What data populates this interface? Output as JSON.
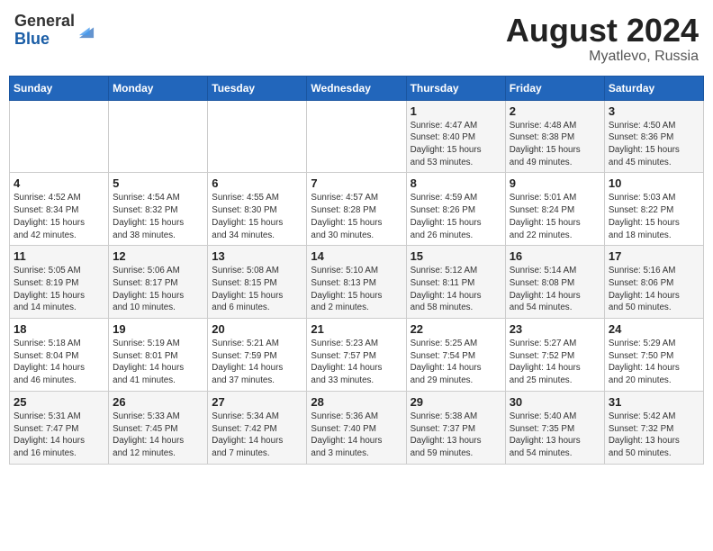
{
  "header": {
    "logo_line1": "General",
    "logo_line2": "Blue",
    "title": "August 2024",
    "location": "Myatlevo, Russia"
  },
  "days_of_week": [
    "Sunday",
    "Monday",
    "Tuesday",
    "Wednesday",
    "Thursday",
    "Friday",
    "Saturday"
  ],
  "weeks": [
    [
      {
        "num": "",
        "info": ""
      },
      {
        "num": "",
        "info": ""
      },
      {
        "num": "",
        "info": ""
      },
      {
        "num": "",
        "info": ""
      },
      {
        "num": "1",
        "info": "Sunrise: 4:47 AM\nSunset: 8:40 PM\nDaylight: 15 hours\nand 53 minutes."
      },
      {
        "num": "2",
        "info": "Sunrise: 4:48 AM\nSunset: 8:38 PM\nDaylight: 15 hours\nand 49 minutes."
      },
      {
        "num": "3",
        "info": "Sunrise: 4:50 AM\nSunset: 8:36 PM\nDaylight: 15 hours\nand 45 minutes."
      }
    ],
    [
      {
        "num": "4",
        "info": "Sunrise: 4:52 AM\nSunset: 8:34 PM\nDaylight: 15 hours\nand 42 minutes."
      },
      {
        "num": "5",
        "info": "Sunrise: 4:54 AM\nSunset: 8:32 PM\nDaylight: 15 hours\nand 38 minutes."
      },
      {
        "num": "6",
        "info": "Sunrise: 4:55 AM\nSunset: 8:30 PM\nDaylight: 15 hours\nand 34 minutes."
      },
      {
        "num": "7",
        "info": "Sunrise: 4:57 AM\nSunset: 8:28 PM\nDaylight: 15 hours\nand 30 minutes."
      },
      {
        "num": "8",
        "info": "Sunrise: 4:59 AM\nSunset: 8:26 PM\nDaylight: 15 hours\nand 26 minutes."
      },
      {
        "num": "9",
        "info": "Sunrise: 5:01 AM\nSunset: 8:24 PM\nDaylight: 15 hours\nand 22 minutes."
      },
      {
        "num": "10",
        "info": "Sunrise: 5:03 AM\nSunset: 8:22 PM\nDaylight: 15 hours\nand 18 minutes."
      }
    ],
    [
      {
        "num": "11",
        "info": "Sunrise: 5:05 AM\nSunset: 8:19 PM\nDaylight: 15 hours\nand 14 minutes."
      },
      {
        "num": "12",
        "info": "Sunrise: 5:06 AM\nSunset: 8:17 PM\nDaylight: 15 hours\nand 10 minutes."
      },
      {
        "num": "13",
        "info": "Sunrise: 5:08 AM\nSunset: 8:15 PM\nDaylight: 15 hours\nand 6 minutes."
      },
      {
        "num": "14",
        "info": "Sunrise: 5:10 AM\nSunset: 8:13 PM\nDaylight: 15 hours\nand 2 minutes."
      },
      {
        "num": "15",
        "info": "Sunrise: 5:12 AM\nSunset: 8:11 PM\nDaylight: 14 hours\nand 58 minutes."
      },
      {
        "num": "16",
        "info": "Sunrise: 5:14 AM\nSunset: 8:08 PM\nDaylight: 14 hours\nand 54 minutes."
      },
      {
        "num": "17",
        "info": "Sunrise: 5:16 AM\nSunset: 8:06 PM\nDaylight: 14 hours\nand 50 minutes."
      }
    ],
    [
      {
        "num": "18",
        "info": "Sunrise: 5:18 AM\nSunset: 8:04 PM\nDaylight: 14 hours\nand 46 minutes."
      },
      {
        "num": "19",
        "info": "Sunrise: 5:19 AM\nSunset: 8:01 PM\nDaylight: 14 hours\nand 41 minutes."
      },
      {
        "num": "20",
        "info": "Sunrise: 5:21 AM\nSunset: 7:59 PM\nDaylight: 14 hours\nand 37 minutes."
      },
      {
        "num": "21",
        "info": "Sunrise: 5:23 AM\nSunset: 7:57 PM\nDaylight: 14 hours\nand 33 minutes."
      },
      {
        "num": "22",
        "info": "Sunrise: 5:25 AM\nSunset: 7:54 PM\nDaylight: 14 hours\nand 29 minutes."
      },
      {
        "num": "23",
        "info": "Sunrise: 5:27 AM\nSunset: 7:52 PM\nDaylight: 14 hours\nand 25 minutes."
      },
      {
        "num": "24",
        "info": "Sunrise: 5:29 AM\nSunset: 7:50 PM\nDaylight: 14 hours\nand 20 minutes."
      }
    ],
    [
      {
        "num": "25",
        "info": "Sunrise: 5:31 AM\nSunset: 7:47 PM\nDaylight: 14 hours\nand 16 minutes."
      },
      {
        "num": "26",
        "info": "Sunrise: 5:33 AM\nSunset: 7:45 PM\nDaylight: 14 hours\nand 12 minutes."
      },
      {
        "num": "27",
        "info": "Sunrise: 5:34 AM\nSunset: 7:42 PM\nDaylight: 14 hours\nand 7 minutes."
      },
      {
        "num": "28",
        "info": "Sunrise: 5:36 AM\nSunset: 7:40 PM\nDaylight: 14 hours\nand 3 minutes."
      },
      {
        "num": "29",
        "info": "Sunrise: 5:38 AM\nSunset: 7:37 PM\nDaylight: 13 hours\nand 59 minutes."
      },
      {
        "num": "30",
        "info": "Sunrise: 5:40 AM\nSunset: 7:35 PM\nDaylight: 13 hours\nand 54 minutes."
      },
      {
        "num": "31",
        "info": "Sunrise: 5:42 AM\nSunset: 7:32 PM\nDaylight: 13 hours\nand 50 minutes."
      }
    ]
  ]
}
